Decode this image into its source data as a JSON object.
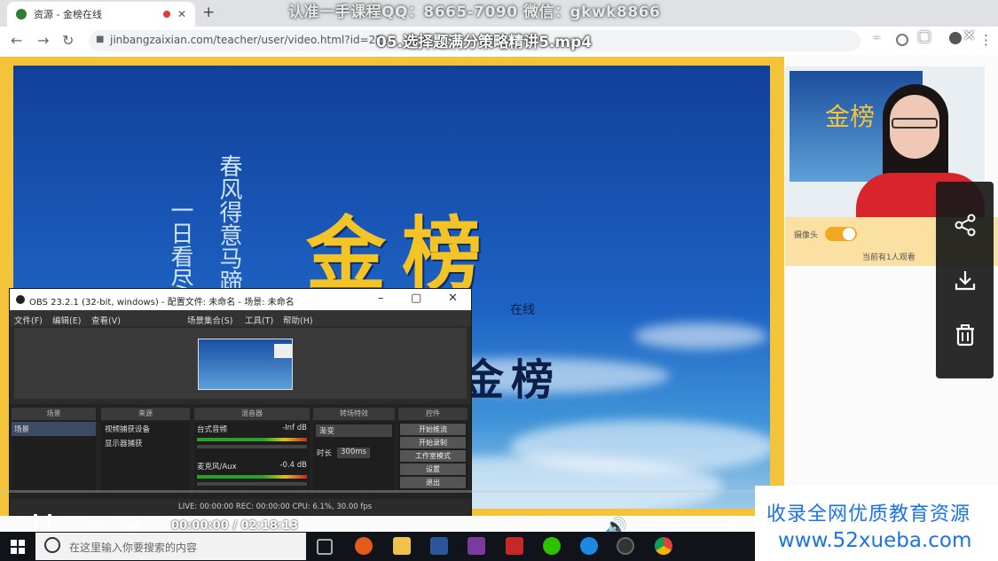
{
  "browser": {
    "tab_title": "资源 - 金榜在线",
    "new_tab_label": "+",
    "url": "jinbangzaixian.com/teacher/user/video.html?id=22",
    "nav": {
      "back": "←",
      "forward": "→",
      "reload": "↻"
    }
  },
  "overlay": {
    "watermark": "认准一手课程QQ：8665-7090 微信：gkwk8866",
    "video_title": "05.选择题满分策略精讲5.mp4",
    "icons": {
      "minimize": "–",
      "maximize": "▢",
      "close": "✕",
      "menu": "⋮"
    }
  },
  "slide": {
    "calligraphy_1": "春风得意马蹄",
    "calligraphy_2": "一日看尽",
    "logo_big": "金榜",
    "logo_small": "在线",
    "logo_mid": "金榜"
  },
  "right_panel": {
    "camera_label": "摄像头",
    "viewers": "当前有1人观看",
    "side_menu": [
      "share-icon",
      "download-icon",
      "trash-icon"
    ]
  },
  "obs": {
    "title": "OBS 23.2.1 (32-bit, windows) - 配置文件: 未命名 - 场景: 未命名",
    "menu": [
      "文件(F)",
      "编辑(E)",
      "查看(V)",
      "场景集合(S)",
      "工具(T)",
      "帮助(H)"
    ],
    "docks": [
      "场景",
      "来源",
      "混音器",
      "转场特效",
      "控件"
    ],
    "scene_item": "场景",
    "sources": [
      "视频捕获设备",
      "显示器捕获"
    ],
    "mixer": [
      {
        "name": "台式音频",
        "level": "-Inf dB"
      },
      {
        "name": "麦克风/Aux",
        "level": "-0.4 dB"
      }
    ],
    "transition": {
      "type": "渐变",
      "duration_label": "时长",
      "duration": "300ms"
    },
    "controls": [
      "开始推流",
      "开始录制",
      "工作室模式",
      "设置",
      "退出"
    ],
    "status": "LIVE: 00:00:00    REC: 00:00:00    CPU: 6.1%, 30.00 fps"
  },
  "player": {
    "time_current": "00:00:00",
    "time_total": "02:18:13",
    "time_sep": " / ",
    "volume": 1.0
  },
  "taskbar": {
    "search_placeholder": "在这里输入你要搜索的内容"
  },
  "ad": {
    "line1": "收录全网优质教育资源",
    "line2": "www.52xueba.com"
  }
}
